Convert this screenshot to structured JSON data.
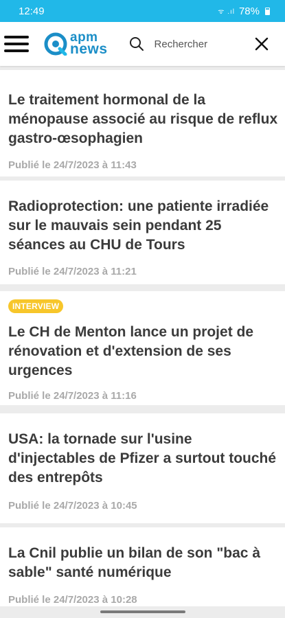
{
  "status_bar": {
    "time": "12:49",
    "signal": "ᯤ .ıl",
    "battery": "78%"
  },
  "header": {
    "logo_line1": "apm",
    "logo_line2": "news",
    "search_placeholder": "Rechercher"
  },
  "articles": [
    {
      "title": "Le traitement hormonal de la ménopause associé au risque de reflux gastro-œsophagien",
      "date": "Publié le 24/7/2023 à 11:43",
      "badge": ""
    },
    {
      "title": "Radioprotection: une patiente irradiée sur le mauvais sein pendant 25 séances au CHU de Tours",
      "date": "Publié le 24/7/2023 à 11:21",
      "badge": ""
    },
    {
      "title": "Le CH de Menton lance un projet de rénovation et d'extension de ses urgences",
      "date": "Publié le 24/7/2023 à 11:16",
      "badge": "INTERVIEW"
    },
    {
      "title": "USA: la tornade sur l'usine d'injectables de Pfizer a surtout touché des entrepôts",
      "date": "Publié le 24/7/2023 à 10:45",
      "badge": ""
    },
    {
      "title": "La Cnil publie un bilan de son \"bac à sable\" santé numérique",
      "date": "Publié le 24/7/2023 à 10:28",
      "badge": ""
    }
  ],
  "colors": {
    "status_bar": "#21b8e8",
    "brand": "#1b8ec7",
    "badge": "#f7c62b"
  }
}
